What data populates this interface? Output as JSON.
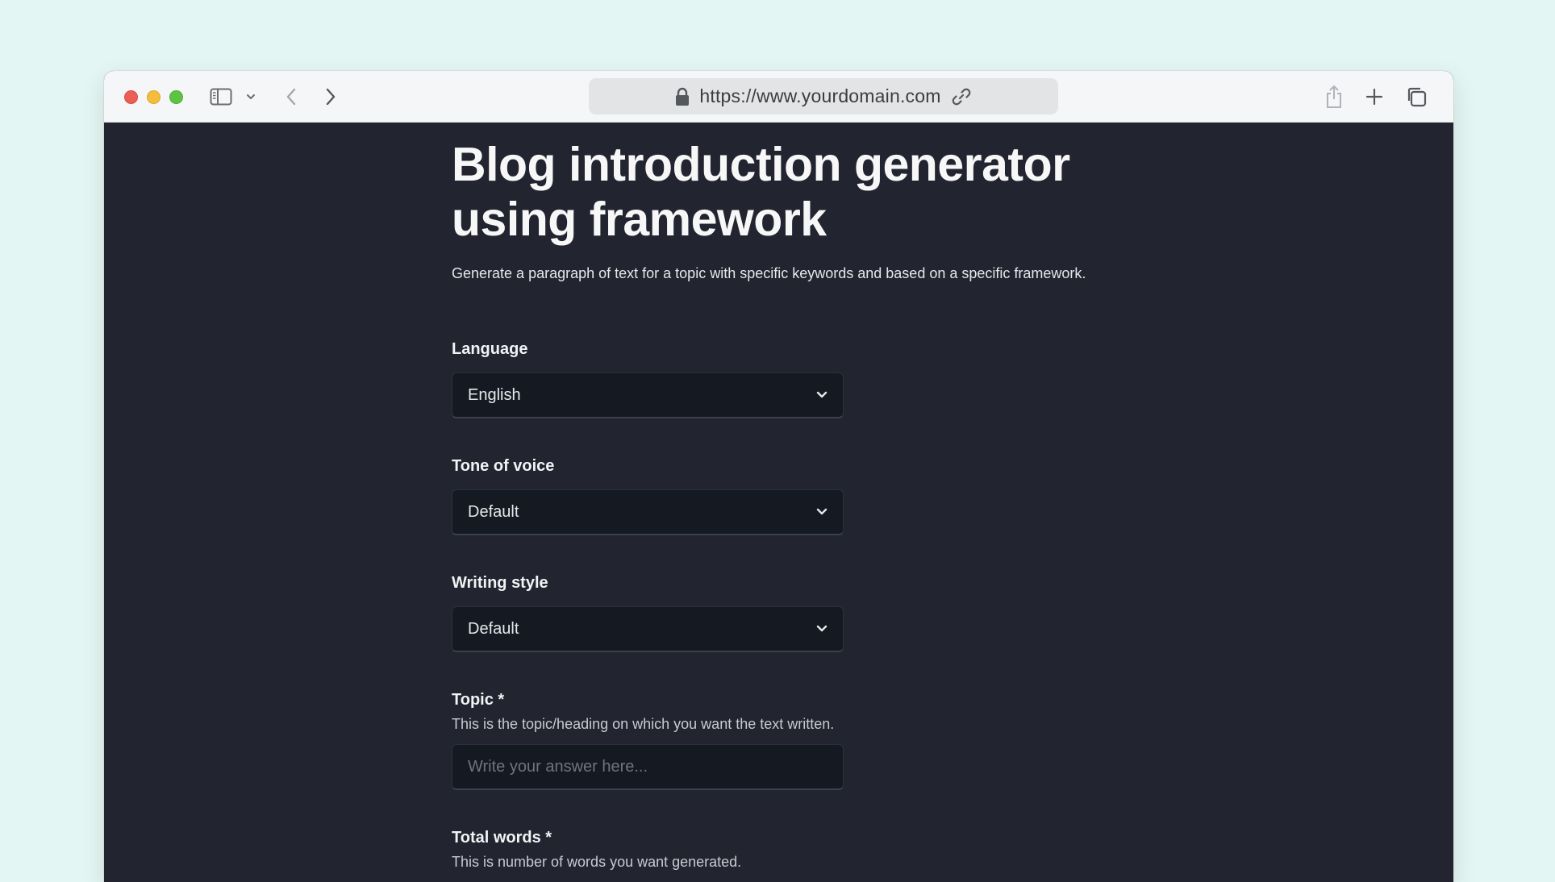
{
  "browser": {
    "url": "https://www.yourdomain.com"
  },
  "page": {
    "title": "Blog introduction generator using framework",
    "description": "Generate a paragraph of text for a topic with specific keywords and based on a specific framework."
  },
  "form": {
    "language": {
      "label": "Language",
      "value": "English"
    },
    "tone": {
      "label": "Tone of voice",
      "value": "Default"
    },
    "style": {
      "label": "Writing style",
      "value": "Default"
    },
    "topic": {
      "label": "Topic *",
      "help": "This is the topic/heading on which you want the text written.",
      "placeholder": "Write your answer here..."
    },
    "total_words": {
      "label": "Total words *",
      "help": "This is number of words you want generated."
    }
  },
  "colors": {
    "page_background": "#e4f6f3",
    "content_background": "#222530",
    "field_background": "#151922"
  }
}
